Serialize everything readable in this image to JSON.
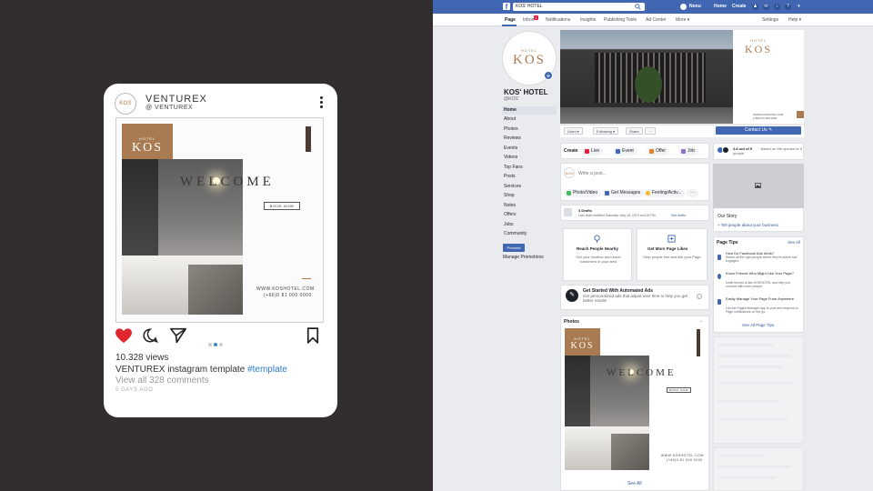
{
  "instagram": {
    "account_name": "VENTUREX",
    "handle": "@ VENTUREX",
    "avatar_text": "KOS",
    "post": {
      "badge_small": "HOTEL",
      "badge_brand": "KOS",
      "headline": "WELCOME",
      "cta": "BOOK NOW",
      "website": "WWW.KOSHOTEL.COM",
      "phone": "(+66)0 81 000 0000"
    },
    "views": "10.328 views",
    "caption_user": "VENTUREX instagram template",
    "caption_tag": "#template",
    "comments_link": "View all 328 comments",
    "time_ago": "5 DAYS AGO",
    "colors": {
      "heart": "#e0262d",
      "active_dot": "#3b86d0",
      "brand_brown": "#a97b52"
    }
  },
  "facebook": {
    "search_value": "KOS' HOTEL",
    "top_links": {
      "profile": "Nonu",
      "home": "Home",
      "create": "Create"
    },
    "tabs": [
      "Page",
      "Inbox",
      "Notifications",
      "Insights",
      "Publishing Tools",
      "Ad Center",
      "More ▾"
    ],
    "inbox_badge": "1",
    "right_tabs": [
      "Settings",
      "Help ▾"
    ],
    "page_name": "KOS' HOTEL",
    "page_handle": "@KOS'",
    "profile_small": "HOTEL",
    "profile_brand": "KOS",
    "nav": [
      "Home",
      "About",
      "Photos",
      "Reviews",
      "Events",
      "Videos",
      "Top Fans",
      "Posts",
      "Services",
      "Shop",
      "Notes",
      "Offers",
      "Jobs",
      "Community"
    ],
    "promote": "Promote",
    "manage_promotions": "Manage Promotions",
    "cover": {
      "small": "HOTEL",
      "brand": "KOS",
      "website": "WWW.KOSHOTEL.COM",
      "phone": "(+66)0 81 000 0000"
    },
    "actions": {
      "liked": "Liked ▾",
      "following": "Following ▾",
      "share": "Share",
      "more": "···",
      "contact": "Contact Us ✎"
    },
    "create": {
      "label": "Create",
      "live": "Live",
      "event": "Event",
      "offer": "Offer",
      "job": "Job"
    },
    "composer": {
      "placeholder": "Write a post...",
      "photo_video": "Photo/Video",
      "get_messages": "Get Messages",
      "feeling": "Feeling/Activ...",
      "more": "···"
    },
    "drafts": {
      "title": "3 Drafts",
      "detail": "Last draft modified Saturday, May 18, 2019 at 6:00 PM.",
      "link": "See drafts."
    },
    "promo_cards": [
      {
        "title": "Reach People Nearby",
        "desc": "Get your location and reach customers in your area"
      },
      {
        "title": "Get More Page Likes",
        "desc": "Help people find and like your Page"
      }
    ],
    "automated_ads": {
      "title": "Get Started With Automated Ads",
      "desc": "Get personalized ads that adjust over time to help you get better results"
    },
    "photos": {
      "title": "Photos",
      "badge_small": "HOTEL",
      "badge_brand": "KOS",
      "headline": "WELCOME",
      "cta": "BOOK NOW",
      "website": "WWW.KOSHOTEL.COM",
      "phone": "(+66)0 81 000 0000",
      "see_all": "See All"
    },
    "rating": {
      "score": "4.8 out of 5",
      "desc": "· Based on the opinion of 8 people"
    },
    "story": {
      "title": "Our Story",
      "link": "+ Tell people about your business"
    },
    "page_tips": {
      "title": "Page Tips",
      "see_all": "See All",
      "items": [
        {
          "title": "How Do Facebook Ads Work?",
          "desc": "Reach all the right people where they're active and engaged."
        },
        {
          "title": "Know Friends Who Might Like Your Page?",
          "desc": "Invite friends to like KOSHOTEL and help you connect with more people."
        },
        {
          "title": "Easily Manage Your Page From Anywhere",
          "desc": "Get the Pages Manager app to post and respond to Page notifications on the go."
        }
      ],
      "see_all_tips": "See All Page Tips"
    },
    "colors": {
      "topbar": "#4267b2",
      "accent": "#4267b2"
    }
  }
}
